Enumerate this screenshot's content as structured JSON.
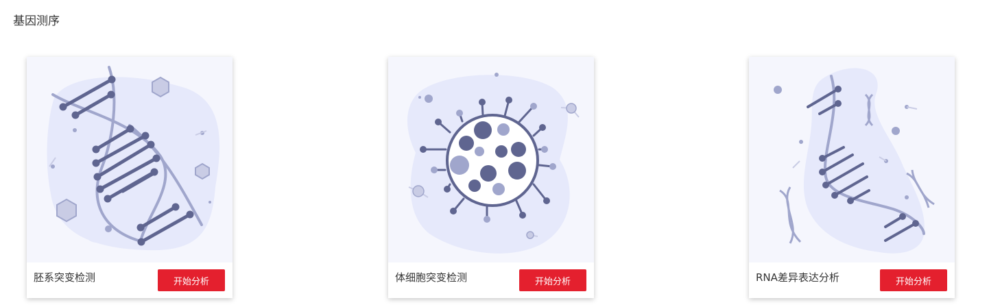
{
  "page": {
    "title": "基因测序"
  },
  "colors": {
    "accent_button": "#e4202e",
    "illustration_background": "#f5f6fd",
    "illustration_blob": "#e6e9fb",
    "illustration_dark": "#5f6590",
    "illustration_light": "#a0a6cc"
  },
  "cards": [
    {
      "label": "胚系突变检测",
      "button_label": "开始分析",
      "illustration": "dna-double-helix-icon"
    },
    {
      "label": "体细胞突变检测",
      "button_label": "开始分析",
      "illustration": "virus-cell-icon"
    },
    {
      "label": "RNA差异表达分析",
      "button_label": "开始分析",
      "illustration": "rna-strand-icon"
    }
  ]
}
